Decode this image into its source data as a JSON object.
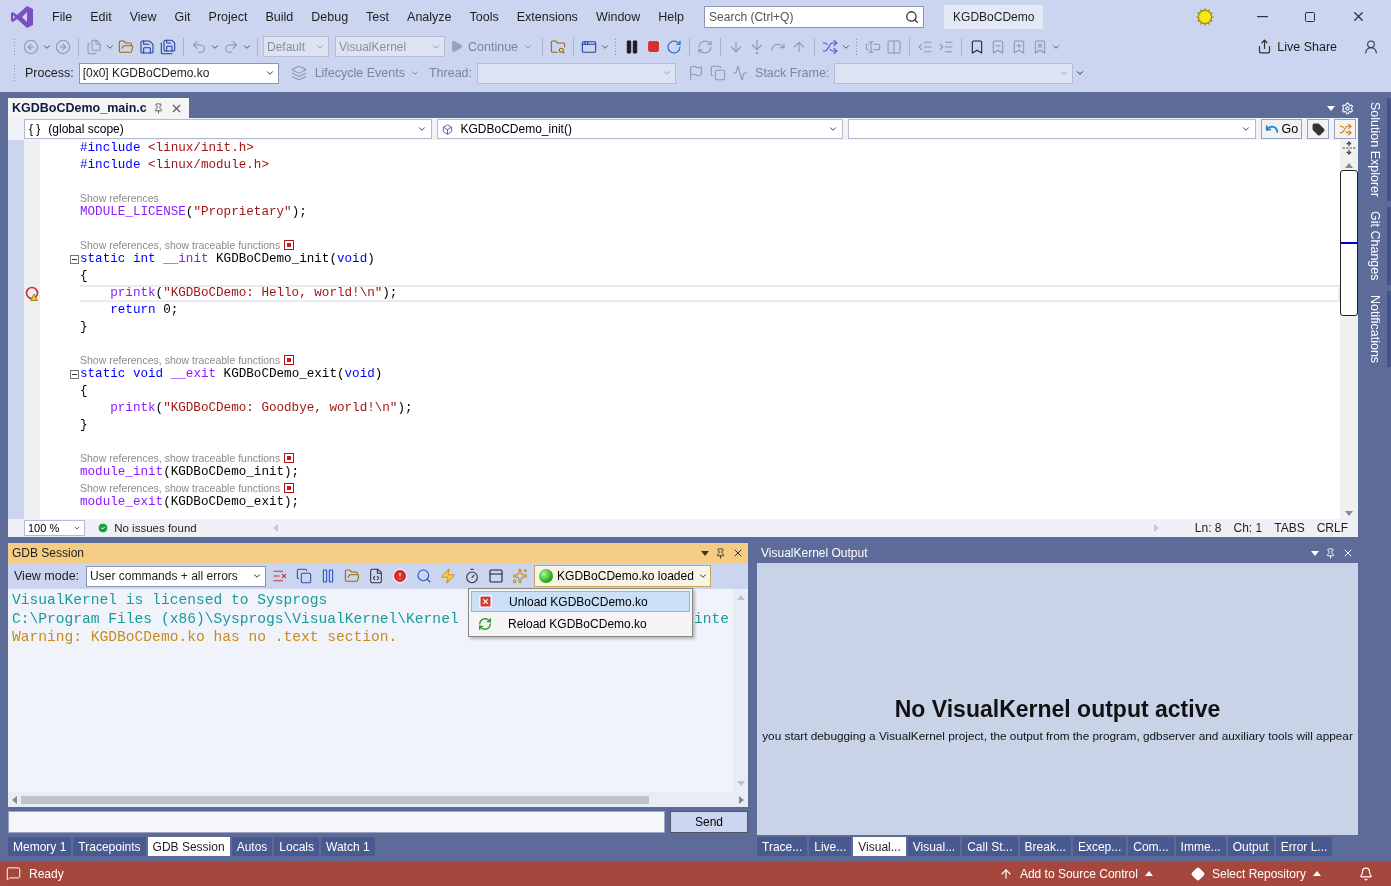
{
  "menu": {
    "items": [
      "File",
      "Edit",
      "View",
      "Git",
      "Project",
      "Build",
      "Debug",
      "Test",
      "Analyze",
      "Tools",
      "Extensions",
      "Window",
      "Help"
    ]
  },
  "search": {
    "placeholder": "Search (Ctrl+Q)"
  },
  "solution_name": "KGDBoCDemo",
  "toolbar": {
    "configuration": {
      "value": "Default",
      "disabled": true
    },
    "platform": {
      "value": "VisualKernel",
      "disabled": true
    },
    "continue": {
      "label": "Continue",
      "disabled": true
    },
    "live_share": "Live Share"
  },
  "debug_location": {
    "process_label": "Process:",
    "process": "[0x0] KGDBoCDemo.ko",
    "lifecycle": "Lifecycle Events",
    "thread_label": "Thread:",
    "stack_frame_label": "Stack Frame:"
  },
  "editor": {
    "tab": {
      "title": "KGDBoCDemo_main.c",
      "selected": true
    },
    "scope_icon": "{ }",
    "scope": "(global scope)",
    "function": "KGDBoCDemo_init()",
    "go": "Go",
    "lines": [
      {
        "kind": "code",
        "tokens": [
          {
            "kind": "keyword",
            "text": "#include"
          },
          {
            "kind": "string",
            "text": " <linux/init.h>"
          }
        ]
      },
      {
        "kind": "code",
        "tokens": [
          {
            "kind": "keyword",
            "text": "#include"
          },
          {
            "kind": "string",
            "text": " <linux/module.h>"
          }
        ]
      },
      {
        "kind": "blank"
      },
      {
        "kind": "lens",
        "text": "Show references"
      },
      {
        "kind": "code",
        "tokens": [
          {
            "kind": "macro",
            "text": "MODULE_LICENSE"
          },
          {
            "kind": "plain",
            "text": "("
          },
          {
            "kind": "string",
            "text": "\"Proprietary\""
          },
          {
            "kind": "plain",
            "text": ");"
          }
        ]
      },
      {
        "kind": "blank"
      },
      {
        "kind": "lens",
        "text": "Show references, show traceable functions",
        "marker": true
      },
      {
        "kind": "code",
        "fold": true,
        "tokens": [
          {
            "kind": "keyword",
            "text": "static"
          },
          {
            "kind": "keyword",
            "text": " int"
          },
          {
            "kind": "macro",
            "text": " __init"
          },
          {
            "kind": "plain",
            "text": " KGDBoCDemo_init("
          },
          {
            "kind": "keyword",
            "text": "void"
          },
          {
            "kind": "plain",
            "text": ")"
          }
        ]
      },
      {
        "kind": "code",
        "tokens": [
          {
            "kind": "plain",
            "text": "{"
          }
        ]
      },
      {
        "kind": "code",
        "current": true,
        "breakpoint": true,
        "tokens": [
          {
            "kind": "macro",
            "text": "    printk"
          },
          {
            "kind": "plain",
            "text": "("
          },
          {
            "kind": "string",
            "text": "\"KGDBoCDemo: Hello, world!\\n\""
          },
          {
            "kind": "plain",
            "text": ");"
          }
        ]
      },
      {
        "kind": "code",
        "tokens": [
          {
            "kind": "keyword",
            "text": "    return"
          },
          {
            "kind": "plain",
            "text": " 0;"
          }
        ]
      },
      {
        "kind": "code",
        "tokens": [
          {
            "kind": "plain",
            "text": "}"
          }
        ]
      },
      {
        "kind": "blank"
      },
      {
        "kind": "lens",
        "text": "Show references, show traceable functions",
        "marker": true
      },
      {
        "kind": "code",
        "fold": true,
        "tokens": [
          {
            "kind": "keyword",
            "text": "static"
          },
          {
            "kind": "keyword",
            "text": " void"
          },
          {
            "kind": "macro",
            "text": " __exit"
          },
          {
            "kind": "plain",
            "text": " KGDBoCDemo_exit("
          },
          {
            "kind": "keyword",
            "text": "void"
          },
          {
            "kind": "plain",
            "text": ")"
          }
        ]
      },
      {
        "kind": "code",
        "tokens": [
          {
            "kind": "plain",
            "text": "{"
          }
        ]
      },
      {
        "kind": "code",
        "tokens": [
          {
            "kind": "macro",
            "text": "    printk"
          },
          {
            "kind": "plain",
            "text": "("
          },
          {
            "kind": "string",
            "text": "\"KGDBoCDemo: Goodbye, world!\\n\""
          },
          {
            "kind": "plain",
            "text": ");"
          }
        ]
      },
      {
        "kind": "code",
        "tokens": [
          {
            "kind": "plain",
            "text": "}"
          }
        ]
      },
      {
        "kind": "blank"
      },
      {
        "kind": "lens",
        "text": "Show references, show traceable functions",
        "marker": true
      },
      {
        "kind": "code",
        "tokens": [
          {
            "kind": "macro",
            "text": "module_init"
          },
          {
            "kind": "plain",
            "text": "(KGDBoCDemo_init);"
          }
        ]
      },
      {
        "kind": "lens",
        "text": "Show references, show traceable functions",
        "marker": true
      },
      {
        "kind": "code",
        "tokens": [
          {
            "kind": "macro",
            "text": "module_exit"
          },
          {
            "kind": "plain",
            "text": "(KGDBoCDemo_exit);"
          }
        ]
      }
    ],
    "zoom": "100 %",
    "issues": "No issues found",
    "line": "Ln: 8",
    "column": "Ch: 1",
    "indent": "TABS",
    "eol": "CRLF"
  },
  "side_tabs": [
    "Solution Explorer",
    "Git Changes",
    "Notifications"
  ],
  "gdb_session": {
    "title": "GDB Session",
    "view_mode_label": "View mode:",
    "view_mode": "User commands + all errors",
    "module_status": "KGDBoCDemo.ko loaded",
    "output": [
      {
        "kind": "info",
        "text": "VisualKernel is licensed to Sysprogs"
      },
      {
        "kind": "info",
        "text": "C:\\Program Files (x86)\\Sysprogs\\VisualKernel\\Kernel",
        "tail": "inte"
      },
      {
        "kind": "warning",
        "text": "Warning: KGDBoCDemo.ko has no .text section."
      }
    ],
    "module_menu": [
      {
        "kind": "unload",
        "label": "Unload KGDBoCDemo.ko",
        "selected": true
      },
      {
        "kind": "reload",
        "label": "Reload KGDBoCDemo.ko",
        "selected": false
      }
    ],
    "send": "Send",
    "tabs": [
      {
        "label": "Memory 1",
        "selected": false
      },
      {
        "label": "Tracepoints",
        "selected": false
      },
      {
        "label": "GDB Session",
        "selected": true
      },
      {
        "label": "Autos",
        "selected": false
      },
      {
        "label": "Locals",
        "selected": false
      },
      {
        "label": "Watch 1",
        "selected": false
      }
    ]
  },
  "output_panel": {
    "title": "VisualKernel Output",
    "heading": "No VisualKernel output active",
    "message": "you start debugging a VisualKernel project, the output from the program, gdbserver and auxiliary tools will appear",
    "tabs": [
      {
        "label": "Trace...",
        "selected": false
      },
      {
        "label": "Live...",
        "selected": false
      },
      {
        "label": "Visual...",
        "selected": true
      },
      {
        "label": "Visual...",
        "selected": false
      },
      {
        "label": "Call St...",
        "selected": false
      },
      {
        "label": "Break...",
        "selected": false
      },
      {
        "label": "Excep...",
        "selected": false
      },
      {
        "label": "Com...",
        "selected": false
      },
      {
        "label": "Imme...",
        "selected": false
      },
      {
        "label": "Output",
        "selected": false
      },
      {
        "label": "Error L...",
        "selected": false
      }
    ]
  },
  "status_bar": {
    "state": "Ready",
    "source_control": "Add to Source Control",
    "repository": "Select Repository"
  }
}
